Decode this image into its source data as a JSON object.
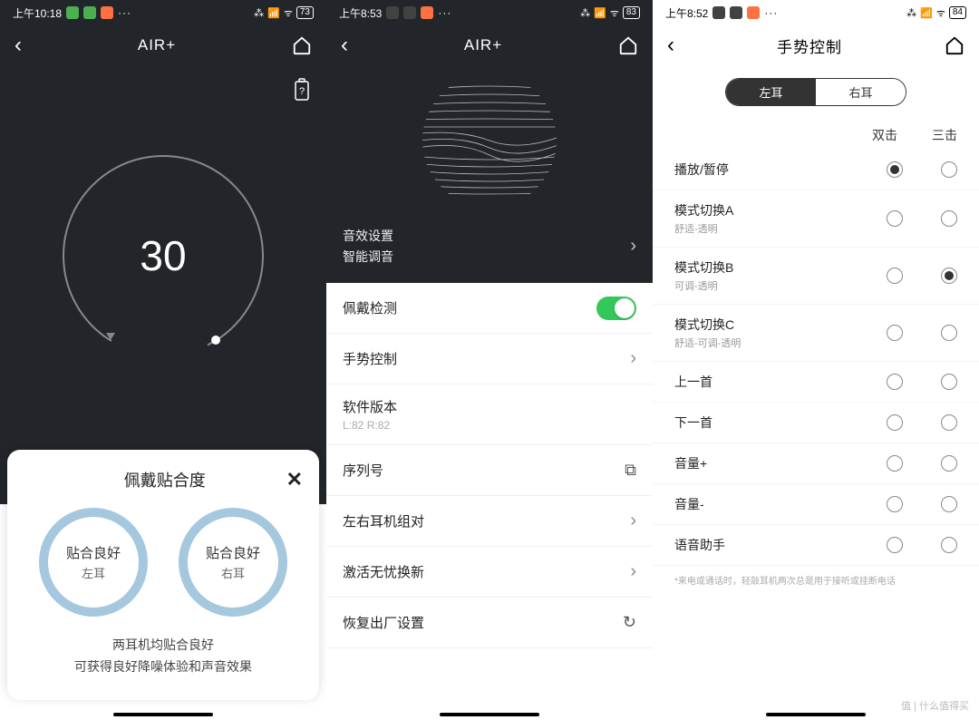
{
  "screen1": {
    "status": {
      "time": "上午10:18",
      "battery": "73"
    },
    "nav_title": "AIR+",
    "gauge_value": "30",
    "sheet": {
      "title": "佩戴贴合度",
      "left": {
        "main": "贴合良好",
        "sub": "左耳"
      },
      "right": {
        "main": "贴合良好",
        "sub": "右耳"
      },
      "line1": "两耳机均贴合良好",
      "line2": "可获得良好降噪体验和声音效果"
    }
  },
  "screen2": {
    "status": {
      "time": "上午8:53",
      "battery": "83"
    },
    "nav_title": "AIR+",
    "hero": {
      "line1": "音效设置",
      "line2": "智能调音"
    },
    "rows": {
      "wear_detect": "佩戴检测",
      "gesture": "手势控制",
      "version": "软件版本",
      "version_sub": "L:82  R:82",
      "serial": "序列号",
      "pair": "左右耳机组对",
      "warranty": "激活无忧换新",
      "reset": "恢复出厂设置"
    }
  },
  "screen3": {
    "status": {
      "time": "上午8:52",
      "battery": "84"
    },
    "nav_title": "手势控制",
    "seg": {
      "left": "左耳",
      "right": "右耳"
    },
    "head": {
      "c1": "双击",
      "c2": "三击"
    },
    "rows": [
      {
        "label": "播放/暂停",
        "sub": "",
        "c1": true,
        "c2": false
      },
      {
        "label": "模式切换A",
        "sub": "舒适-透明",
        "c1": false,
        "c2": false
      },
      {
        "label": "模式切换B",
        "sub": "可调-透明",
        "c1": false,
        "c2": true
      },
      {
        "label": "模式切换C",
        "sub": "舒适-可调-透明",
        "c1": false,
        "c2": false
      },
      {
        "label": "上一首",
        "sub": "",
        "c1": false,
        "c2": false
      },
      {
        "label": "下一首",
        "sub": "",
        "c1": false,
        "c2": false
      },
      {
        "label": "音量+",
        "sub": "",
        "c1": false,
        "c2": false
      },
      {
        "label": "音量-",
        "sub": "",
        "c1": false,
        "c2": false
      },
      {
        "label": "语音助手",
        "sub": "",
        "c1": false,
        "c2": false
      }
    ],
    "note": "*来电或通话时，轻敲耳机两次总是用于接听或挂断电话"
  },
  "watermark": "值 | 什么值得买"
}
